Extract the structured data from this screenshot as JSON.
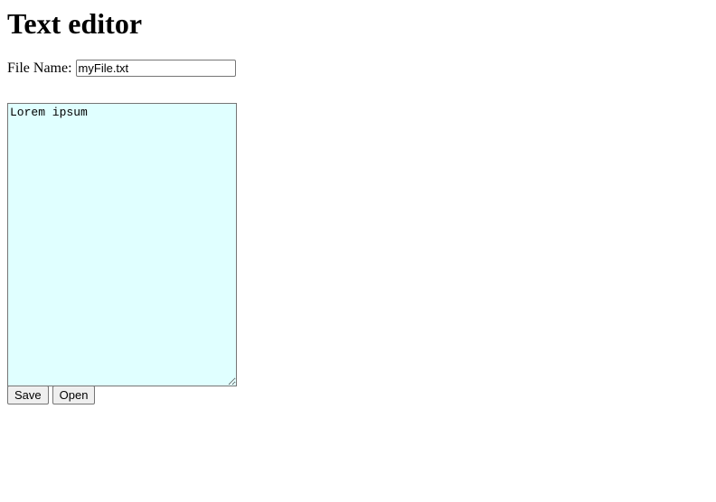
{
  "page": {
    "title": "Text editor"
  },
  "file": {
    "label": "File Name:",
    "value": "myFile.txt"
  },
  "editor": {
    "content": "Lorem ipsum",
    "background_color": "#e0ffff"
  },
  "buttons": {
    "save_label": "Save",
    "open_label": "Open"
  }
}
